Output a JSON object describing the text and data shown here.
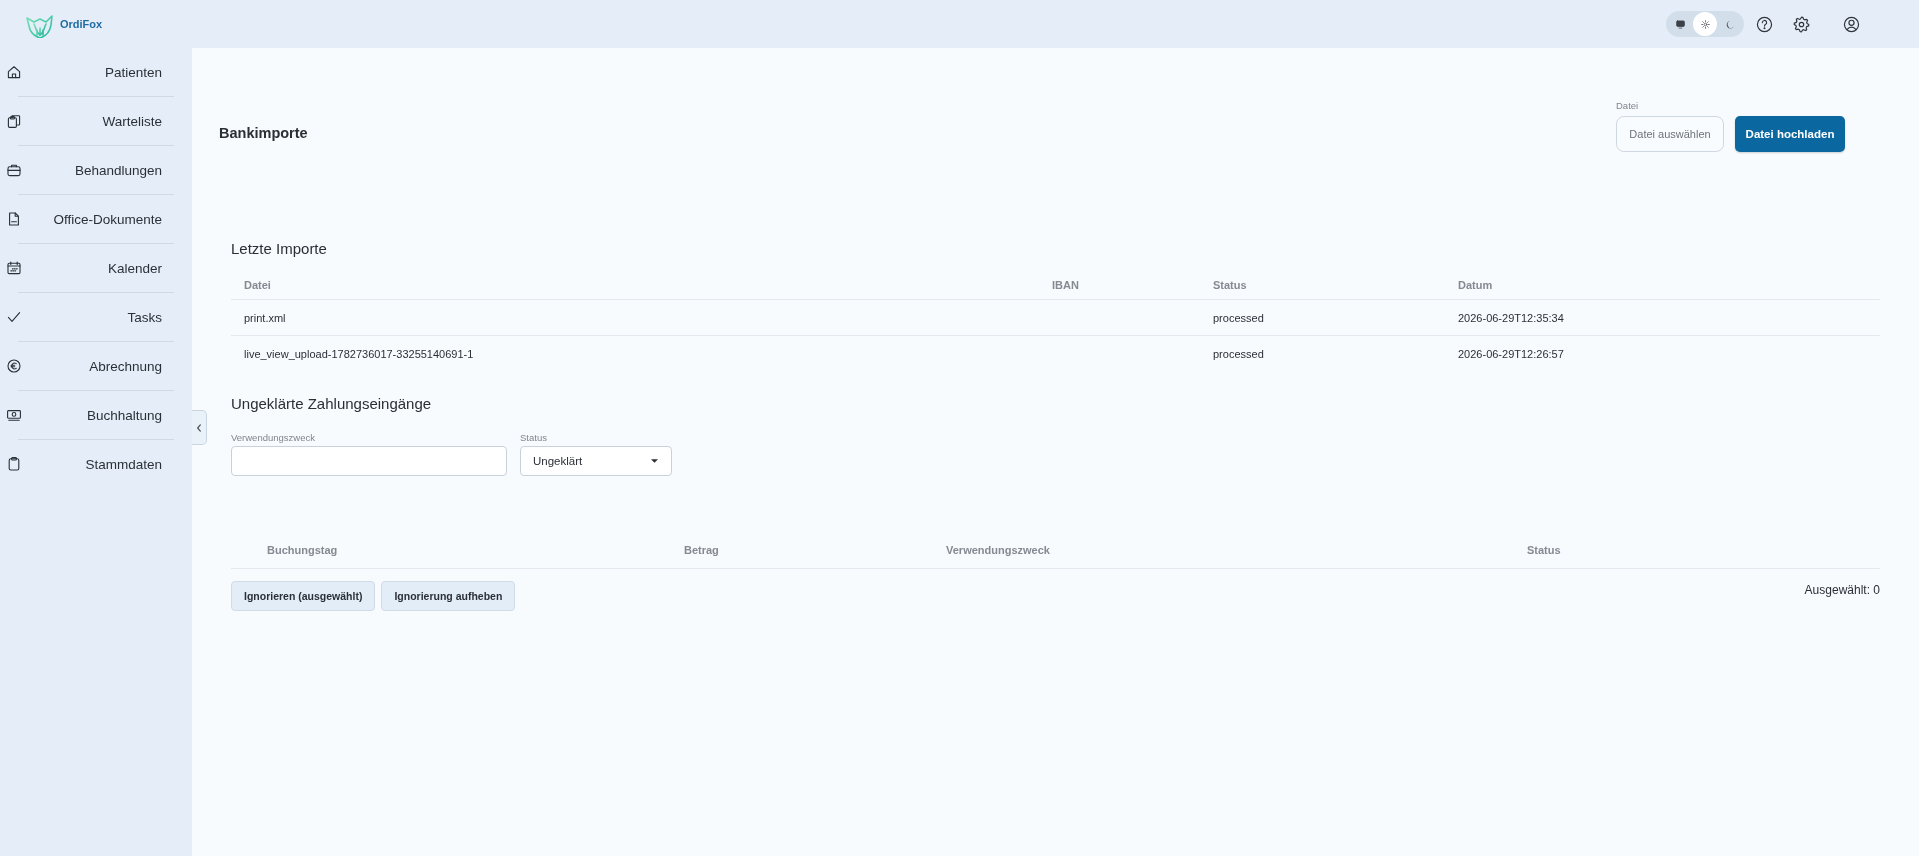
{
  "header": {
    "logo_text": "OrdiFox",
    "theme_toggle": [
      {
        "kind": "system",
        "selected": false
      },
      {
        "kind": "light",
        "selected": true
      },
      {
        "kind": "dark",
        "selected": false
      }
    ],
    "actions": [
      {
        "kind": "help"
      },
      {
        "kind": "settings"
      },
      {
        "kind": "account"
      }
    ]
  },
  "sidebar": {
    "items": [
      {
        "kind": "home",
        "label": "Patienten",
        "selected": false
      },
      {
        "kind": "clipboards",
        "label": "Warteliste",
        "selected": false
      },
      {
        "kind": "briefcase",
        "label": "Behandlungen",
        "selected": false
      },
      {
        "kind": "document",
        "label": "Office-Dokumente",
        "selected": false
      },
      {
        "kind": "calendar",
        "label": "Kalender",
        "selected": false
      },
      {
        "kind": "check",
        "label": "Tasks",
        "selected": false
      },
      {
        "kind": "euro",
        "label": "Abrechnung",
        "selected": false
      },
      {
        "kind": "banknote",
        "label": "Buchhaltung",
        "selected": false
      },
      {
        "kind": "clipboard",
        "label": "Stammdaten",
        "selected": false
      }
    ]
  },
  "page": {
    "title": "Bankimporte",
    "upload": {
      "label": "Datei",
      "file_button": "Datei auswählen",
      "submit_button": "Datei hochladen"
    }
  },
  "imports": {
    "title": "Letzte Importe",
    "columns": [
      "Datei",
      "IBAN",
      "Status",
      "Datum"
    ],
    "rows": [
      {
        "file": "print.xml",
        "status": "processed",
        "date": "2026-06-29T12:35:34"
      },
      {
        "file": "live_view_upload-1782736017-33255140691-1",
        "status": "processed",
        "date": "2026-06-29T12:26:57"
      }
    ]
  },
  "unresolved": {
    "title": "Ungeklärte Zahlungseingänge",
    "filters": {
      "purpose": {
        "label": "Verwendungszweck"
      },
      "status": {
        "label": "Status",
        "value": "Ungeklärt"
      }
    },
    "columns": [
      "Buchungstag",
      "Betrag",
      "Verwendungszweck",
      "Status"
    ],
    "buttons": [
      "Ignorieren (ausgewählt)",
      "Ignorierung aufheben"
    ],
    "selection_count": "Ausgewählt: 0"
  }
}
